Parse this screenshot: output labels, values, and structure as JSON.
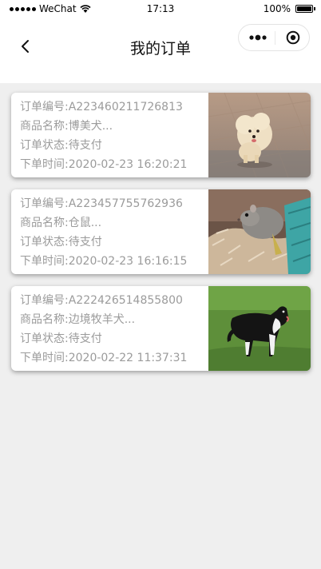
{
  "status_bar": {
    "carrier": "WeChat",
    "time": "17:13",
    "battery": "100%"
  },
  "nav": {
    "title": "我的订单"
  },
  "labels": {
    "order_no": "订单编号:",
    "product": "商品名称:",
    "status": "订单状态:",
    "time": "下单时间:"
  },
  "orders": [
    {
      "order_no": "A223460211726813",
      "product": "博美犬...",
      "status": "待支付",
      "time": "2020-02-23 16:20:21",
      "image_icon": "pomeranian-photo-icon"
    },
    {
      "order_no": "A223457755762936",
      "product": "仓鼠...",
      "status": "待支付",
      "time": "2020-02-23 16:16:15",
      "image_icon": "hamster-photo-icon"
    },
    {
      "order_no": "A222426514855800",
      "product": "边境牧羊犬...",
      "status": "待支付",
      "time": "2020-02-22 11:37:31",
      "image_icon": "border-collie-photo-icon"
    }
  ],
  "colors": {
    "page_bg": "#efefef",
    "card_bg": "#ffffff",
    "text_muted": "#9b9b9b"
  }
}
